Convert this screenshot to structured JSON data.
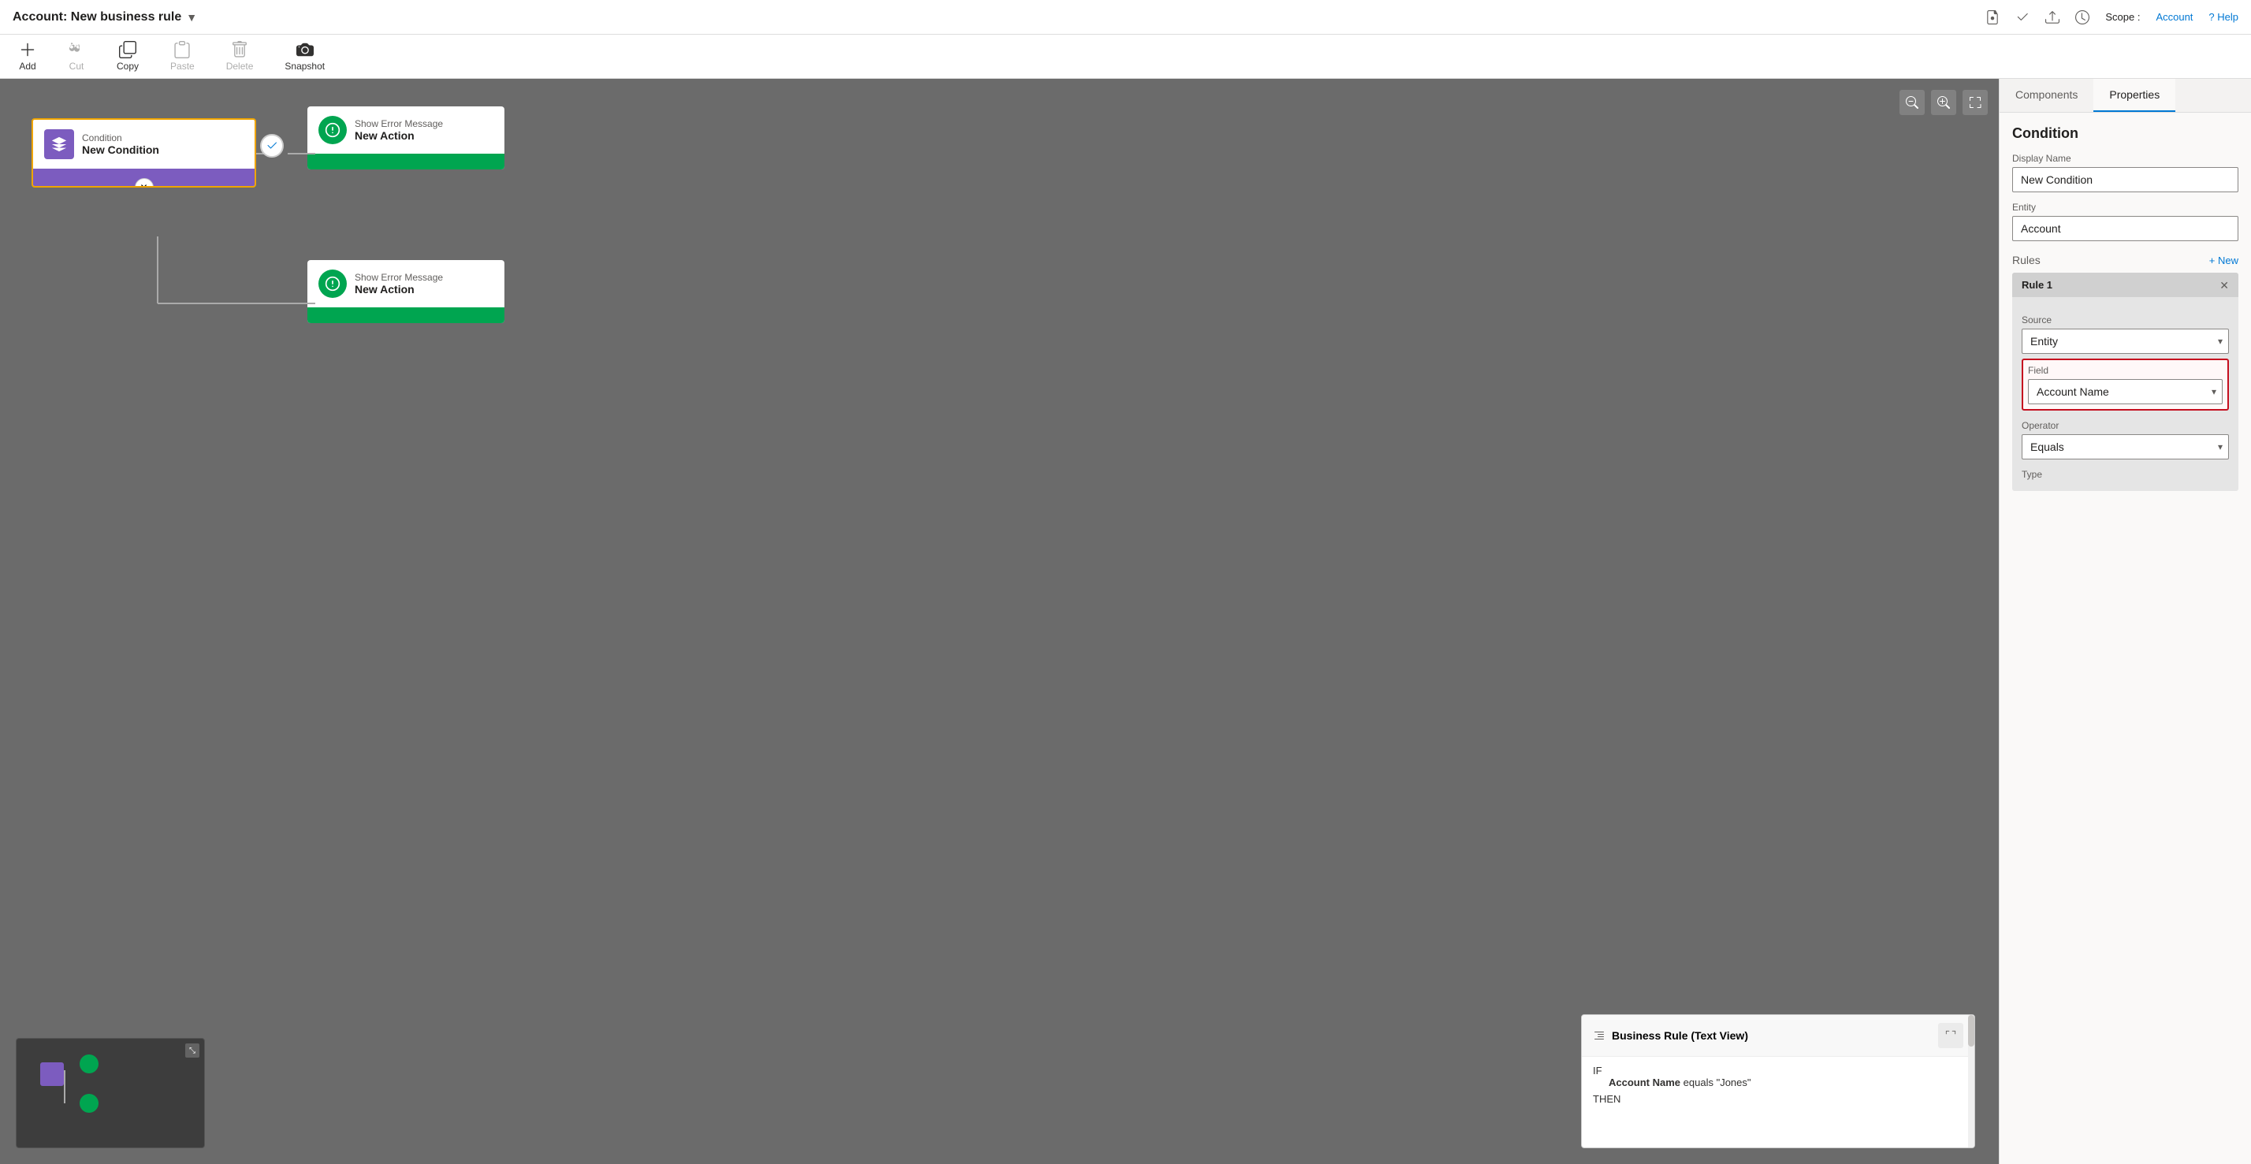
{
  "titleBar": {
    "title": "Account: New business rule",
    "chevron": "▼",
    "actions": {
      "save": "💾",
      "check": "📋",
      "publish": "📤",
      "history": "🕐"
    },
    "scope": {
      "label": "Scope :",
      "value": "Account"
    },
    "help": "? Help"
  },
  "toolbar": {
    "add": "Add",
    "cut": "Cut",
    "copy": "Copy",
    "paste": "Paste",
    "delete": "Delete",
    "snapshot": "Snapshot"
  },
  "canvas": {
    "condition": {
      "type": "Condition",
      "name": "New Condition"
    },
    "action1": {
      "type": "Show Error Message",
      "name": "New Action"
    },
    "action2": {
      "type": "Show Error Message",
      "name": "New Action"
    }
  },
  "textView": {
    "title": "Business Rule (Text View)",
    "ifLabel": "IF",
    "condition": "Account Name equals \"Jones\"",
    "thenLabel": "THEN",
    "fieldName": "Account Name"
  },
  "rightPanel": {
    "tabs": [
      "Components",
      "Properties"
    ],
    "activeTab": "Properties",
    "sectionTitle": "Condition",
    "displayNameLabel": "Display Name",
    "displayNameValue": "New Condition",
    "entityLabel": "Entity",
    "entityValue": "Account",
    "rulesLabel": "Rules",
    "newRuleLabel": "+ New",
    "rule1": {
      "title": "Rule 1",
      "sourceLabel": "Source",
      "sourceValue": "Entity",
      "fieldLabel": "Field",
      "fieldValue": "Account Name",
      "operatorLabel": "Operator",
      "operatorValue": "Equals",
      "typeLabel": "Type"
    }
  }
}
